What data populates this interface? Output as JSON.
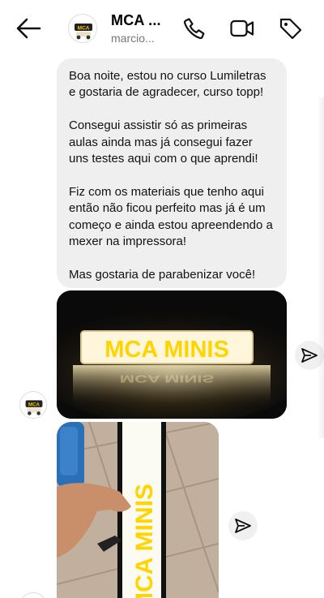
{
  "header": {
    "back_icon": "arrow-left-icon",
    "contact_name": "MCA ...",
    "username": "marcio...",
    "call_icon": "phone-icon",
    "video_icon": "video-camera-icon",
    "tag_icon": "tag-icon",
    "avatar_text": "MCA"
  },
  "messages": [
    {
      "type": "text",
      "paragraphs": [
        "Boa noite, estou no curso Lumiletras e gostaria de agradecer, curso topp!",
        "Consegui assistir só as primeiras aulas ainda mas já consegui fazer uns testes aqui com o que aprendi!",
        "Fiz com os materiais que tenho aqui então não ficou perfeito mas já é um começo e ainda estou apreendendo a mexer na impressora!",
        "Mas gostaria de parabenizar você!"
      ]
    },
    {
      "type": "image",
      "sign_text": "MCA MINIS",
      "share_icon": "paper-plane-icon"
    },
    {
      "type": "image",
      "sign_text": "MCA MINIS",
      "share_icon": "paper-plane-icon"
    }
  ],
  "colors": {
    "bubble": "#efefef",
    "sign_yellow": "#ffd400"
  }
}
